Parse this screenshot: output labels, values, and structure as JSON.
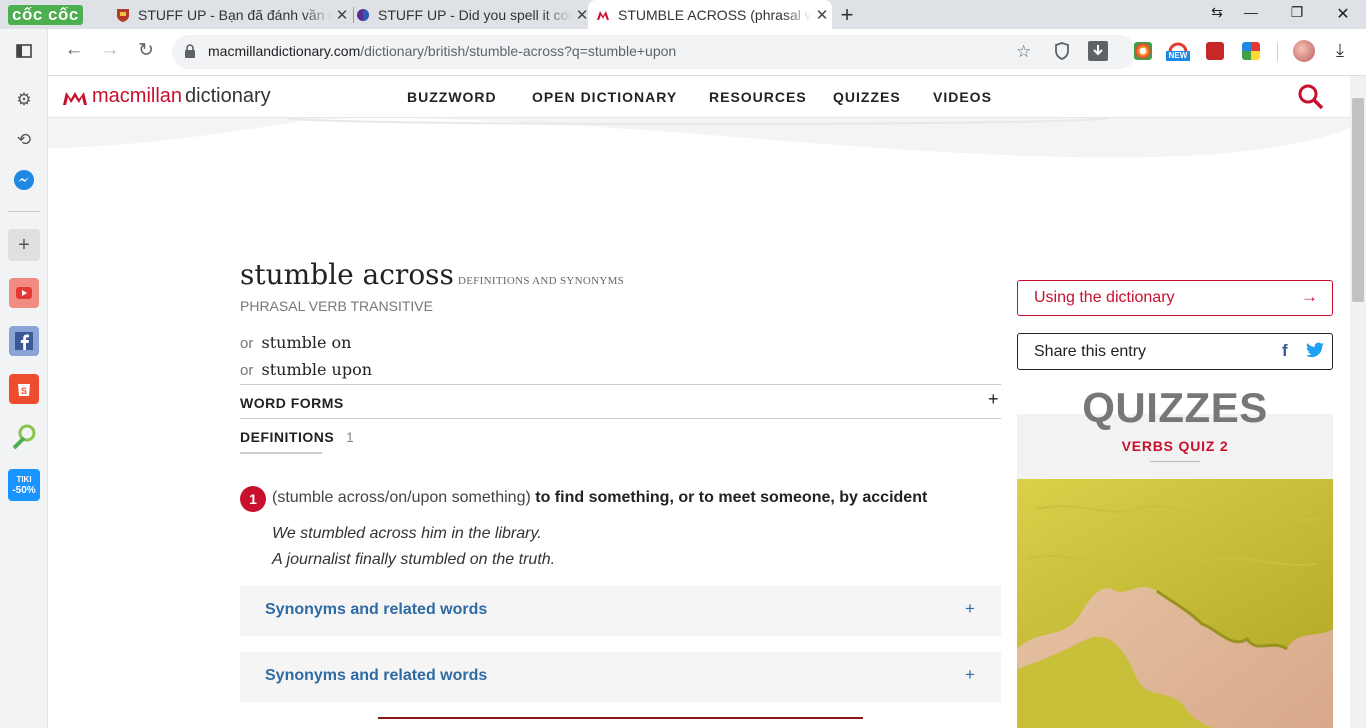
{
  "browser": {
    "brand": "cốc cốc",
    "tabs": [
      {
        "title": "STUFF UP - Bạn đã đánh vần đúng chưa?",
        "icon": "crest-icon"
      },
      {
        "title": "STUFF UP - Did you spell it correctly?",
        "icon": "globe-icon"
      },
      {
        "title": "STUMBLE ACROSS (phrasal verb) definition",
        "icon": "macmillan-icon",
        "active": true
      }
    ],
    "url_host": "macmillandictionary.com",
    "url_path": "/dictionary/british/stumble-across?q=stumble+upon",
    "ext_new_badge": "NEW"
  },
  "sidebar": {
    "tiki_label": "TIKI",
    "tiki_discount": "-50%",
    "shopee_label": "24.4"
  },
  "site": {
    "logo_brand": "macmillan",
    "logo_dict": "dictionary",
    "nav": [
      "BUZZWORD",
      "OPEN DICTIONARY",
      "RESOURCES",
      "QUIZZES",
      "VIDEOS"
    ]
  },
  "entry": {
    "headword": "stumble across",
    "headword_sub": "DEFINITIONS AND SYNONYMS",
    "pos": "PHRASAL VERB  TRANSITIVE",
    "or_label": "or",
    "variants": [
      "stumble on",
      "stumble upon"
    ],
    "word_forms": "WORD FORMS",
    "word_forms_toggle": "+",
    "definitions_label": "DEFINITIONS",
    "definitions_count": "1",
    "sense_number": "1",
    "sense_grammar": "(stumble across/on/upon something)",
    "sense_definition": "to find something, or to meet someone, by accident",
    "examples": [
      "We stumbled across him in the library.",
      "A journalist finally stumbled on the truth."
    ],
    "synonyms_label": "Synonyms and related words",
    "synonyms_toggle": "+"
  },
  "aside": {
    "using_dictionary": "Using the dictionary",
    "using_arrow": "→",
    "share_entry": "Share this entry",
    "share_fb": "f",
    "quizzes_title": "QUIZZES",
    "quiz_name": "VERBS QUIZ 2"
  },
  "colors": {
    "brand_red": "#c8102e",
    "link_blue": "#2e6aa3",
    "browser_green": "#4caf50"
  }
}
